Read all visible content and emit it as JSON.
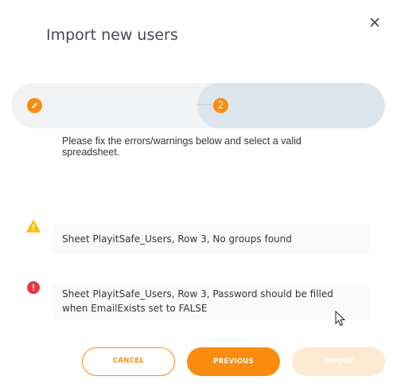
{
  "dialog": {
    "title": "Import new users",
    "close_icon": "close-icon"
  },
  "stepper": {
    "step1_icon": "pencil-icon",
    "step2_number": "2",
    "accent": "#f98c0f"
  },
  "instructions": "Please fix the errors/warnings below and select a valid spreadsheet.",
  "messages": [
    {
      "level": "warning",
      "icon": "warning-icon",
      "color": "#f6c21a",
      "text": "Sheet PlayitSafe_Users, Row 3, No groups found"
    },
    {
      "level": "error",
      "icon": "error-icon",
      "color": "#e5373f",
      "text": "Sheet PlayitSafe_Users, Row 3, Password should be filled when EmailExists set to FALSE"
    }
  ],
  "buttons": {
    "cancel": "CANCEL",
    "previous": "PREVIOUS",
    "import": "IMPORT"
  }
}
